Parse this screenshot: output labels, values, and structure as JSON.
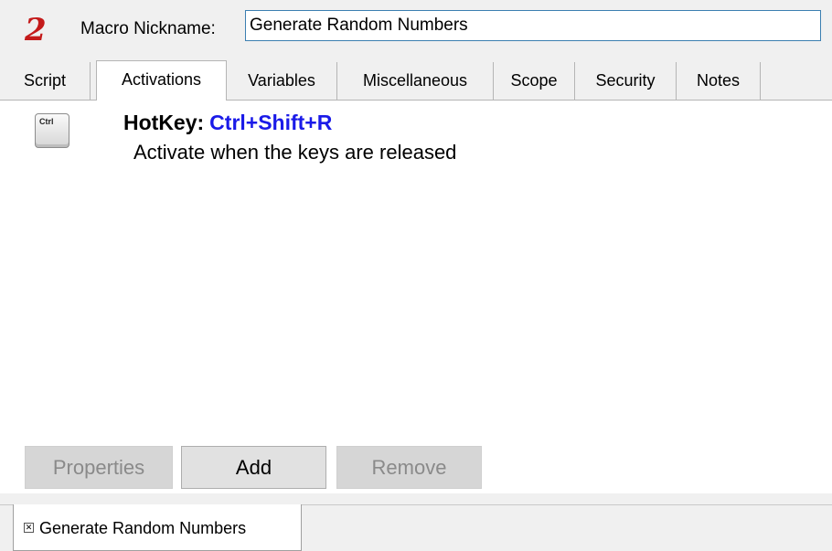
{
  "header": {
    "logo_glyph": "2",
    "nickname_label": "Macro Nickname:",
    "nickname_value": "Generate Random Numbers"
  },
  "tabs": [
    {
      "label": "Script",
      "active": false
    },
    {
      "label": "Activations",
      "active": true
    },
    {
      "label": "Variables",
      "active": false
    },
    {
      "label": "Miscellaneous",
      "active": false
    },
    {
      "label": "Scope",
      "active": false
    },
    {
      "label": "Security",
      "active": false
    },
    {
      "label": "Notes",
      "active": false
    }
  ],
  "activation": {
    "key_icon_label": "Ctrl",
    "key_icon": "keyboard-key-icon",
    "hotkey_label": "HotKey:",
    "hotkey_value": "Ctrl+Shift+R",
    "description": "Activate when the keys are released"
  },
  "buttons": {
    "properties": "Properties",
    "add": "Add",
    "remove": "Remove"
  },
  "document_tab": {
    "label": "Generate Random Numbers",
    "close_icon": "close-icon"
  },
  "colors": {
    "logo_red": "#c41a1a",
    "hotkey_blue": "#1a1ae8",
    "input_border": "#3c7fb1"
  }
}
